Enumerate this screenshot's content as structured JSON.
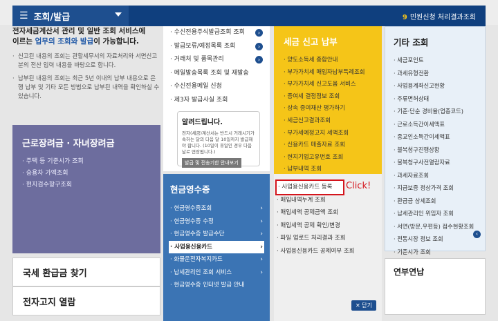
{
  "menu": {
    "title": "조회/발급"
  },
  "status": {
    "count": "9",
    "label": "민원신청 처리결과조회"
  },
  "intro": {
    "title_part1": "전자세금계산서 관리 및 일반 조회 서비스에",
    "title_part2_pre": "이르는 ",
    "title_highlight": "업무의 조회와 발급",
    "title_part2_post": "이 가능합니다.",
    "items": [
      "신고된 내용의 조회는 관할세무서의 자료처리와 서면신고분의 전산 입력 내용을 바탕으로 합니다.",
      "납부된 내용의 조회는 최근 5년 이내의 납부 내용으로 은행 납부 및 기타 모든 방법으로 납부된 내역을 확인하실 수 있습니다."
    ]
  },
  "purple": {
    "title": "근로장려금 · 자녀장려금",
    "items": [
      "주택 등 기준시가 조회",
      "승용차 가액조회",
      "현지검수항구조회"
    ]
  },
  "buttons": {
    "refund": "국세 환급금 찾기",
    "enotice": "전자고지 열람",
    "year_end": "연부연납"
  },
  "white_col": {
    "items": [
      "수신전용주식발급조회 조회",
      "발급보류/예정목록 조회",
      "거래처 및 품목관리",
      "메일발송목록 조회 및 재발송",
      "수신전용메일 신청",
      "제3자 발급사실 조회"
    ],
    "notice_title": "알려드립니다.",
    "notice_text": "전자(세금)계산서는 반드시 거래시기가 속하는 달의 다음 달 10일까지 발급해야 합니다. (10일이 휴일인 경우 다음날로 연장됩니다.)",
    "notice_button": "발급 및 전송기한 안내보기"
  },
  "blue_col": {
    "title": "현금영수증",
    "items": [
      "현금영수증조회",
      "현금영수증 수정",
      "현금영수증 발급수단",
      "사업용신용카드",
      "화물운전자복지카드",
      "납세관리인 조회 서비스",
      "현금영수증 인터넷 발급 안내"
    ]
  },
  "yellow_col": {
    "title": "세금 신고 납부",
    "items": [
      "양도소득세 종합안내",
      "부가가치세 매입자납부특례조회",
      "부가가치세 신고도움 서비스",
      "증여세 결정정보 조회",
      "상속 증여재산 평가하기",
      "세금신고결과조회",
      "부가세예정고지 세액조회",
      "신용카드 매출자료 조회",
      "현지기업고유번호 조회",
      "납부내역 조회"
    ]
  },
  "gray_col": {
    "items": [
      "사업용신용카드 등록",
      "매입내역누계 조회",
      "매입세액 공제금액 조회",
      "매입세액 공제 확인/변경",
      "파일 업로드 처리결과 조회",
      "사업용신용카드 공제여부 조회"
    ],
    "close_label": "닫기"
  },
  "annotation": {
    "click": "Click!"
  },
  "right_col": {
    "title": "기타 조회",
    "items": [
      "세금포인트",
      "과세유형전환",
      "사업용계좌신고현황",
      "주류면허상태",
      "기준·단순 경비율(업종코드)",
      "근로소득간이세액표",
      "종교인소득간이세액표",
      "불복청구진행상황",
      "불복청구사전열람자료",
      "과세자료조회",
      "지급보증 정상가격 조회",
      "환급금 상세조회",
      "납세관리인 위임자 조회",
      "서면(방문,우편등) 접수현황조회",
      "전통시장 정보 조회",
      "기준시가 조회"
    ]
  },
  "colors": {
    "navy": "#1e4f8f",
    "blue": "#3b74b4",
    "yellow": "#f5c518",
    "purple": "#6d6d9e",
    "red": "#d4141c"
  }
}
